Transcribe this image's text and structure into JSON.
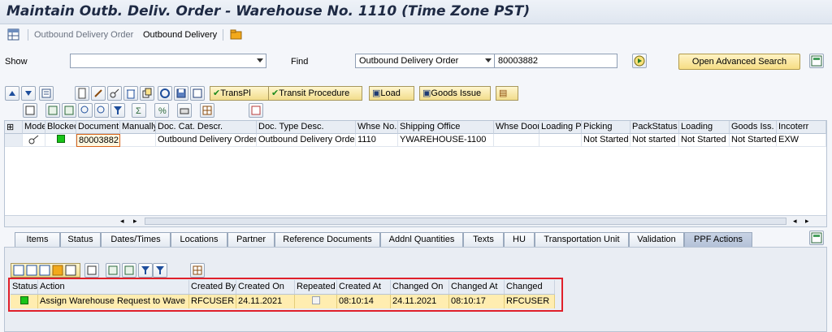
{
  "window": {
    "title": "Maintain Outb. Deliv. Order - Warehouse No. 1110 (Time Zone PST)"
  },
  "menu": {
    "item1": "Outbound Delivery Order",
    "item2": "Outbound Delivery"
  },
  "search": {
    "show_label": "Show",
    "show_value": "",
    "find_label": "Find",
    "find_select": "Outbound Delivery Order",
    "find_value": "80003882",
    "advanced_label": "Open Advanced Search"
  },
  "toolbar": {
    "transpl": "TransPl",
    "transit": "Transit Procedure",
    "load": "Load",
    "goods_issue": "Goods Issue"
  },
  "grid": {
    "headers": [
      "Mode",
      "Blocked",
      "Document",
      "Manually",
      "Doc. Cat. Descr.",
      "Doc. Type Desc.",
      "Whse No.",
      "Shipping Office",
      "Whse Door",
      "Loading Pt",
      "Picking",
      "PackStatus",
      "Loading",
      "Goods Iss.",
      "Incoterr"
    ],
    "row": {
      "document": "80003882",
      "doc_cat": "Outbound Delivery Order",
      "doc_type": "Outbound Delivery Order",
      "whse_no": "1110",
      "shipping_office": "YWAREHOUSE-1100",
      "picking": "Not Started",
      "pack_status": "Not started",
      "loading": "Not Started",
      "goods_issue": "Not Started",
      "incoterms": "EXW"
    }
  },
  "tabs": [
    "Items",
    "Status",
    "Dates/Times",
    "Locations",
    "Partner",
    "Reference Documents",
    "Addnl Quantities",
    "Texts",
    "HU",
    "Transportation Unit",
    "Validation",
    "PPF Actions"
  ],
  "ppf": {
    "headers": [
      "Status",
      "Action",
      "Created By",
      "Created On",
      "Repeated",
      "Created At",
      "Changed On",
      "Changed At",
      "Changed"
    ],
    "row": {
      "action": "Assign Warehouse Request to Wave",
      "created_by": "RFCUSER",
      "created_on": "24.11.2021",
      "created_at": "08:10:14",
      "changed_on": "24.11.2021",
      "changed_at": "08:10:17",
      "changed_by": "RFCUSER"
    }
  },
  "colors": {
    "accent": "#f6dd84",
    "selected_tab": "#b4c2d8",
    "highlight": "#e0202a",
    "status_green": "#18c418"
  }
}
